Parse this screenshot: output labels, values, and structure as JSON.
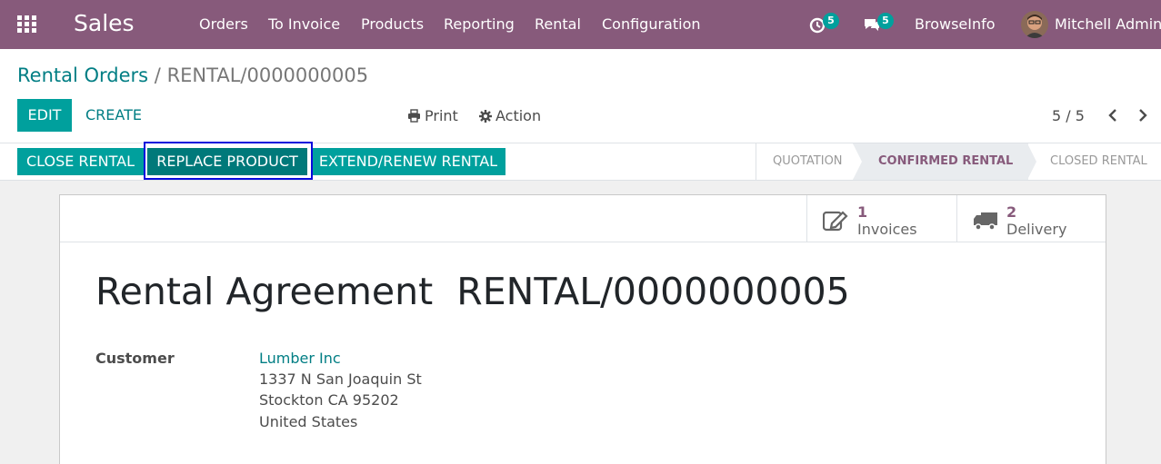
{
  "navbar": {
    "app_name": "Sales",
    "menu": [
      "Orders",
      "To Invoice",
      "Products",
      "Reporting",
      "Rental",
      "Configuration"
    ],
    "activity_count": "5",
    "message_count": "5",
    "company": "BrowseInfo",
    "user": "Mitchell Admin",
    "bg_color": "#875a7b"
  },
  "breadcrumb": {
    "parent": "Rental Orders",
    "separator": "/",
    "current": "RENTAL/0000000005"
  },
  "control": {
    "edit_label": "EDIT",
    "create_label": "CREATE",
    "print_label": "Print",
    "action_label": "Action",
    "pager": "5 / 5"
  },
  "statusbar": {
    "buttons": [
      "CLOSE RENTAL",
      "REPLACE PRODUCT",
      "EXTEND/RENEW RENTAL"
    ],
    "stages": [
      "QUOTATION",
      "CONFIRMED RENTAL",
      "CLOSED RENTAL"
    ],
    "active_stage": "CONFIRMED RENTAL"
  },
  "smart_buttons": [
    {
      "value": "1",
      "label": "Invoices",
      "icon": "edit-icon"
    },
    {
      "value": "2",
      "label": "Delivery",
      "icon": "truck-icon"
    }
  ],
  "form": {
    "title_prefix": "Rental Agreement",
    "title_number": "RENTAL/0000000005",
    "customer_label": "Customer",
    "customer_name": "Lumber Inc",
    "address": [
      "1337 N San Joaquin St",
      "Stockton CA 95202",
      "United States"
    ]
  },
  "colors": {
    "primary": "#00a09d",
    "link": "#017e84",
    "brand": "#875a7b"
  }
}
